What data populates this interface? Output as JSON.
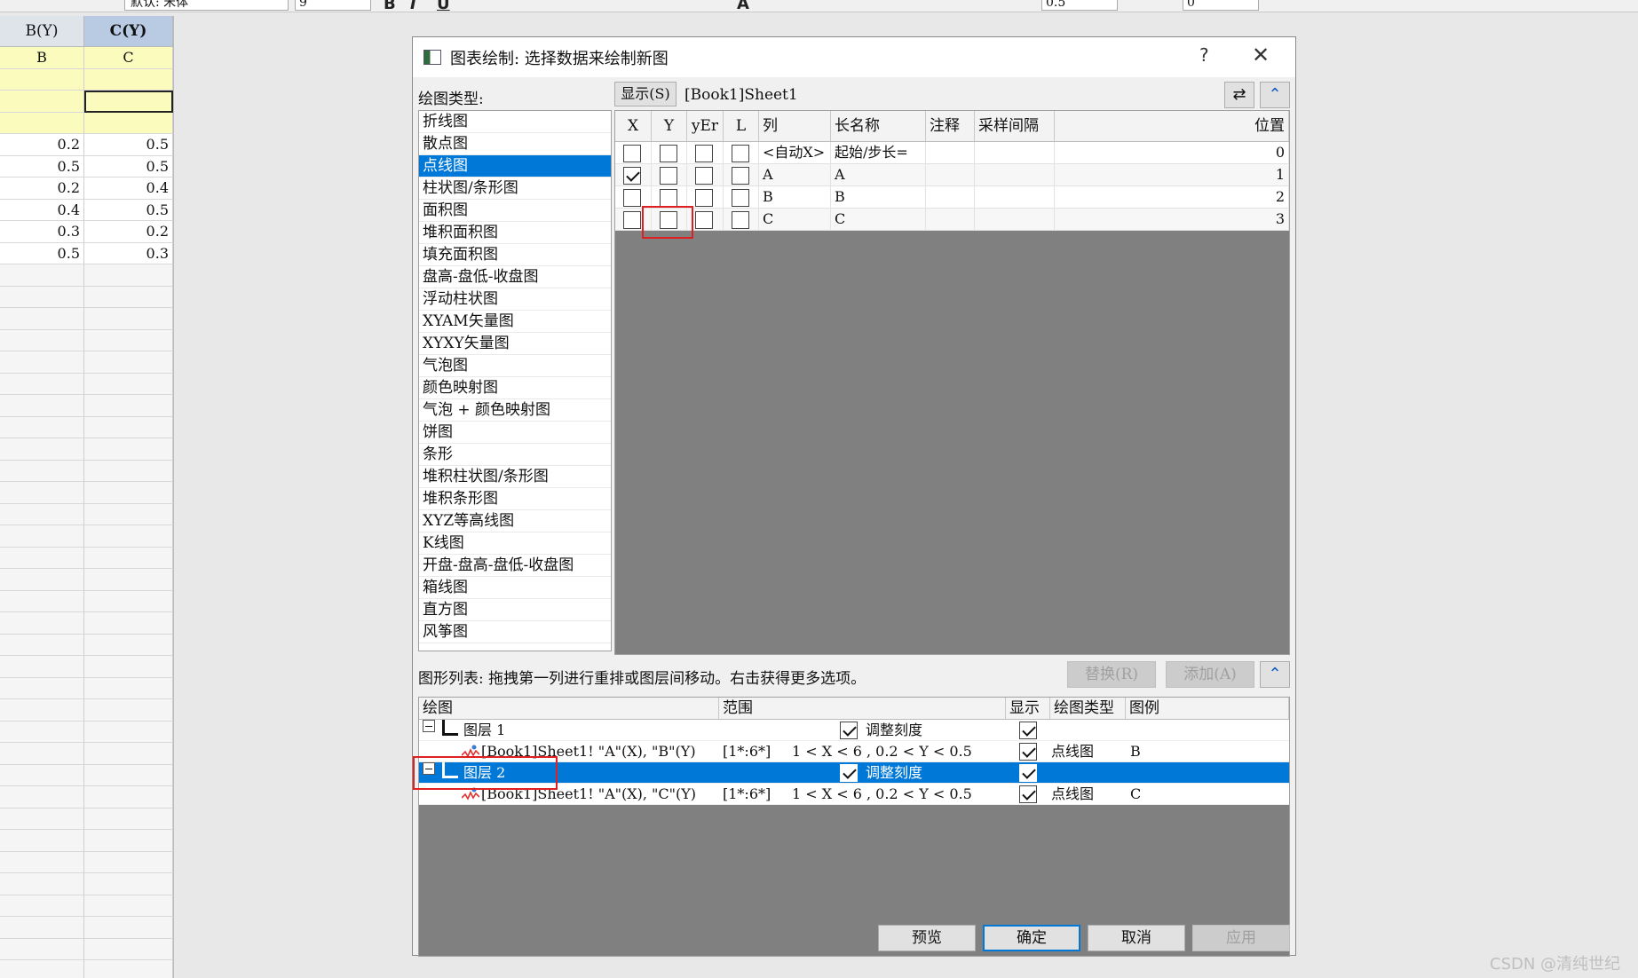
{
  "toolbar": {
    "font_name": "默认: 宋体",
    "font_size": "9",
    "value_a": "0.5",
    "value_b": "0"
  },
  "sheet": {
    "col_headers": [
      "B(Y)",
      "C(Y)"
    ],
    "long_names": [
      "B",
      "C"
    ],
    "rows": [
      [
        "0.2",
        "0.5"
      ],
      [
        "0.5",
        "0.5"
      ],
      [
        "0.2",
        "0.4"
      ],
      [
        "0.4",
        "0.5"
      ],
      [
        "0.3",
        "0.2"
      ],
      [
        "0.5",
        "0.3"
      ]
    ]
  },
  "dialog": {
    "title": "图表绘制: 选择数据来绘制新图",
    "help": "?",
    "close": "✕",
    "plot_type_label": "绘图类型:",
    "plot_types": [
      "折线图",
      "散点图",
      "点线图",
      "柱状图/条形图",
      "面积图",
      "堆积面积图",
      "填充面积图",
      "盘高-盘低-收盘图",
      "浮动柱状图",
      "XYAM矢量图",
      "XYXY矢量图",
      "气泡图",
      "颜色映射图",
      "气泡 + 颜色映射图",
      "饼图",
      "条形",
      "堆积柱状图/条形图",
      "堆积条形图",
      "XYZ等高线图",
      "K线图",
      "开盘-盘高-盘低-收盘图",
      "箱线图",
      "直方图",
      "风筝图"
    ],
    "selected_plot_type": "点线图",
    "show_button": "显示(S)",
    "source": "[Book1]Sheet1",
    "col_table": {
      "headers": [
        "X",
        "Y",
        "yEr",
        "L",
        "列",
        "长名称",
        "注释",
        "采样间隔",
        "位置"
      ],
      "rows": [
        {
          "x": false,
          "y": false,
          "yer": false,
          "l": false,
          "col": "<自动X>",
          "name": "起始/步长=",
          "note": "",
          "sampling": "",
          "pos": "0"
        },
        {
          "x": true,
          "y": false,
          "yer": false,
          "l": false,
          "col": "A",
          "name": "A",
          "note": "",
          "sampling": "",
          "pos": "1"
        },
        {
          "x": false,
          "y": false,
          "yer": false,
          "l": false,
          "col": "B",
          "name": "B",
          "note": "",
          "sampling": "",
          "pos": "2"
        },
        {
          "x": false,
          "y": false,
          "yer": false,
          "l": false,
          "col": "C",
          "name": "C",
          "note": "",
          "sampling": "",
          "pos": "3"
        }
      ]
    },
    "graph_list_label": "图形列表: 拖拽第一列进行重排或图层间移动。右击获得更多选项。",
    "replace_button": "替换(R)",
    "add_button": "添加(A)",
    "graph_list": {
      "headers": [
        "绘图",
        "范围",
        "显示",
        "绘图类型",
        "图例"
      ],
      "layers": [
        {
          "name": "图层 1",
          "rescale": "调整刻度",
          "rescale_checked": true,
          "show": true,
          "selected": false,
          "plot": {
            "text": "[Book1]Sheet1! \"A\"(X), \"B\"(Y)",
            "range": "[1*:6*]",
            "bounds": "1 < X < 6 , 0.2 < Y < 0.5",
            "show": true,
            "type": "点线图",
            "legend": "B"
          }
        },
        {
          "name": "图层 2",
          "rescale": "调整刻度",
          "rescale_checked": true,
          "show": true,
          "selected": true,
          "plot": {
            "text": "[Book1]Sheet1! \"A\"(X), \"C\"(Y)",
            "range": "[1*:6*]",
            "bounds": "1 < X < 6 , 0.2 < Y < 0.5",
            "show": true,
            "type": "点线图",
            "legend": "C"
          }
        }
      ]
    },
    "buttons": {
      "preview": "预览",
      "ok": "确定",
      "cancel": "取消",
      "apply": "应用"
    }
  },
  "watermark": "CSDN @清纯世纪",
  "colors": {
    "selection": "#0078d7",
    "highlight_box": "#e02020",
    "grid_background": "#808080"
  }
}
